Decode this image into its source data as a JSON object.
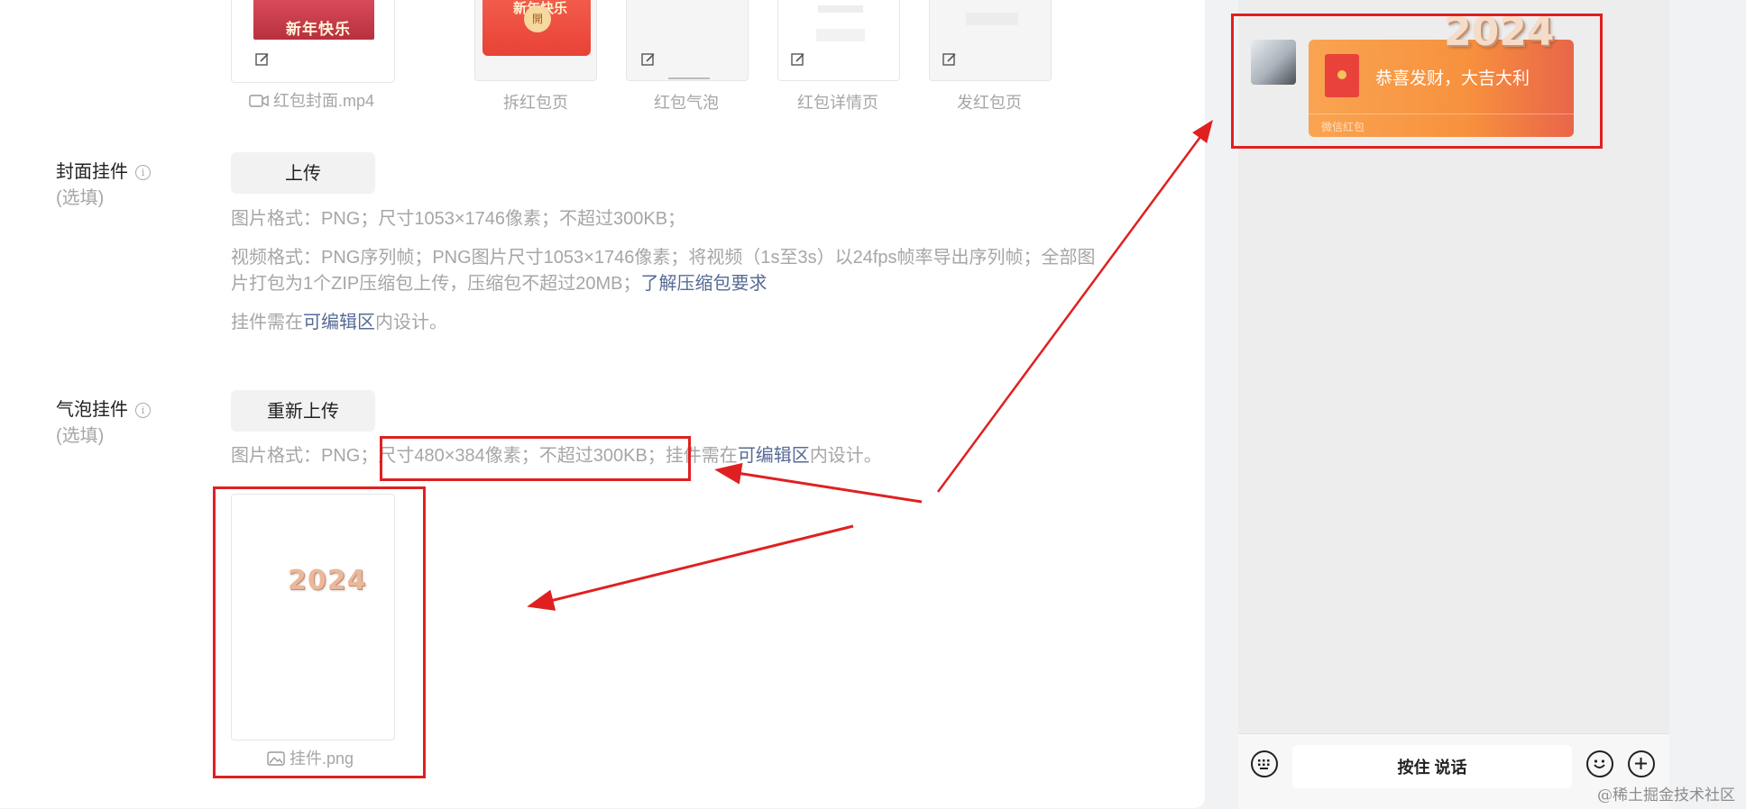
{
  "thumbs": {
    "cover_text": "新年快乐",
    "cover_label": "红包封面.mp4",
    "open_button_char": "開",
    "items": [
      {
        "label": "拆红包页"
      },
      {
        "label": "红包气泡"
      },
      {
        "label": "红包详情页"
      },
      {
        "label": "发红包页"
      }
    ]
  },
  "cover_widget": {
    "label": "封面挂件",
    "optional": "(选填)",
    "upload_label": "上传",
    "hint1": "图片格式：PNG；尺寸1053×1746像素；不超过300KB；",
    "hint2_line1": "视频格式：PNG序列帧；PNG图片尺寸1053×1746像素；将视频（1s至3s）以24fps帧率导出序列帧；全部图",
    "hint2_line2": "片打包为1个ZIP压缩包上传，压缩包不超过20MB；",
    "hint2_link": "了解压缩包要求",
    "hint3_pre": "挂件需在",
    "hint3_link": "可编辑区",
    "hint3_post": "内设计。"
  },
  "bubble_widget": {
    "label": "气泡挂件",
    "optional": "(选填)",
    "upload_label": "重新上传",
    "hint_pre": "图片格式：PNG；",
    "hint_size": "尺寸480×384像素；不超过300KB；",
    "hint_mid": "挂件需在",
    "hint_link": "可编辑区",
    "hint_post": "内设计。",
    "preview_text": "2024",
    "file_label": "挂件.png"
  },
  "phone": {
    "year_text": "2024",
    "bubble_message": "恭喜发财，大吉大利",
    "bubble_footer": "微信红包",
    "hold_to_talk": "按住 说话"
  },
  "watermark": "@稀土掘金技术社区",
  "colors": {
    "annotation_red": "#e02020",
    "link_blue": "#576b95",
    "envelope_orange": "#f79a45",
    "envelope_red": "#e8423a"
  }
}
